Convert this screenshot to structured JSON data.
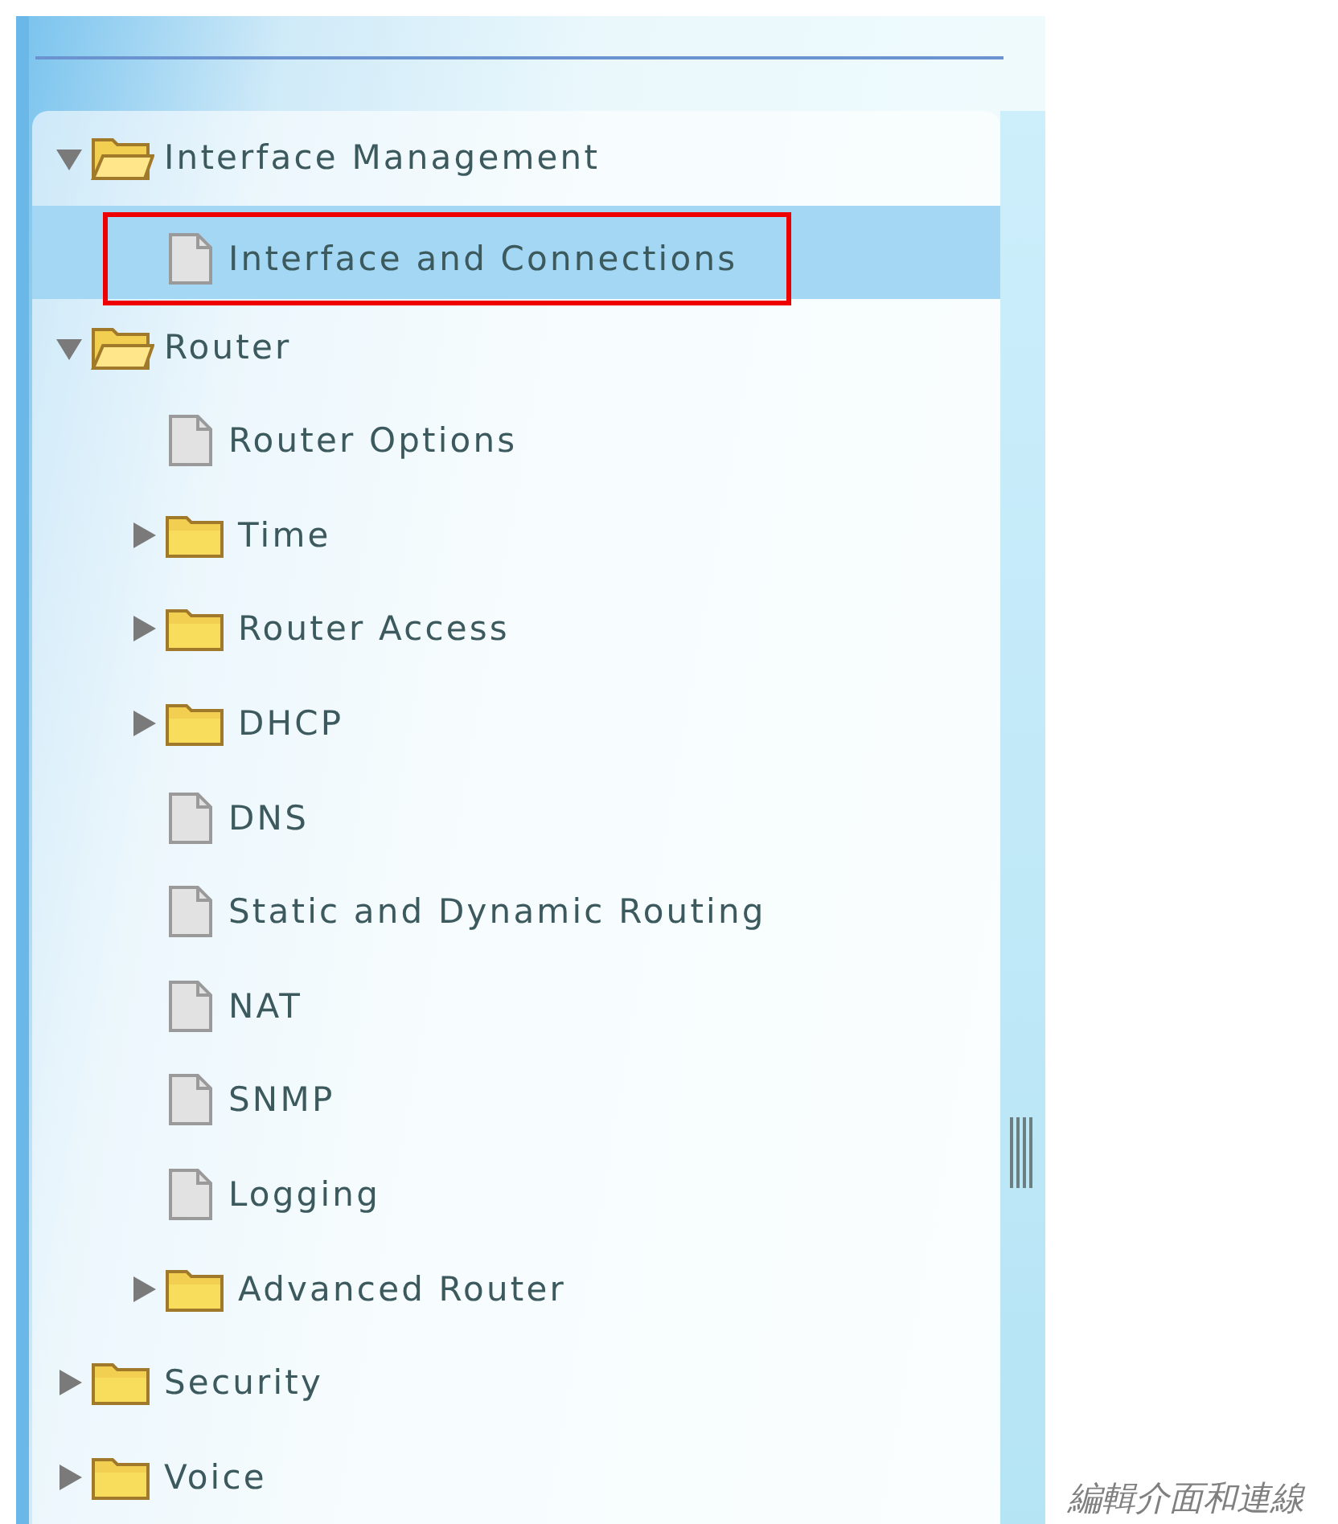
{
  "tree": [
    {
      "kind": "folder",
      "label": "Interface Management",
      "expanded": true,
      "selected": false,
      "outlined": false,
      "children": [
        {
          "kind": "document",
          "label": "Interface and Connections",
          "selected": true,
          "outlined": true
        }
      ]
    },
    {
      "kind": "folder",
      "label": "Router",
      "expanded": true,
      "selected": false,
      "outlined": false,
      "children": [
        {
          "kind": "document",
          "label": "Router Options",
          "selected": false,
          "outlined": false
        },
        {
          "kind": "folder",
          "label": "Time",
          "expanded": false,
          "selected": false,
          "outlined": false
        },
        {
          "kind": "folder",
          "label": "Router Access",
          "expanded": false,
          "selected": false,
          "outlined": false
        },
        {
          "kind": "folder",
          "label": "DHCP",
          "expanded": false,
          "selected": false,
          "outlined": false
        },
        {
          "kind": "document",
          "label": "DNS",
          "selected": false,
          "outlined": false
        },
        {
          "kind": "document",
          "label": "Static and Dynamic Routing",
          "selected": false,
          "outlined": false
        },
        {
          "kind": "document",
          "label": "NAT",
          "selected": false,
          "outlined": false
        },
        {
          "kind": "document",
          "label": "SNMP",
          "selected": false,
          "outlined": false
        },
        {
          "kind": "document",
          "label": "Logging",
          "selected": false,
          "outlined": false
        },
        {
          "kind": "folder",
          "label": "Advanced Router",
          "expanded": false,
          "selected": false,
          "outlined": false
        }
      ]
    },
    {
      "kind": "folder",
      "label": "Security",
      "expanded": false,
      "selected": false,
      "outlined": false
    },
    {
      "kind": "folder",
      "label": "Voice",
      "expanded": false,
      "selected": false,
      "outlined": false
    }
  ],
  "caption": "編輯介面和連線"
}
